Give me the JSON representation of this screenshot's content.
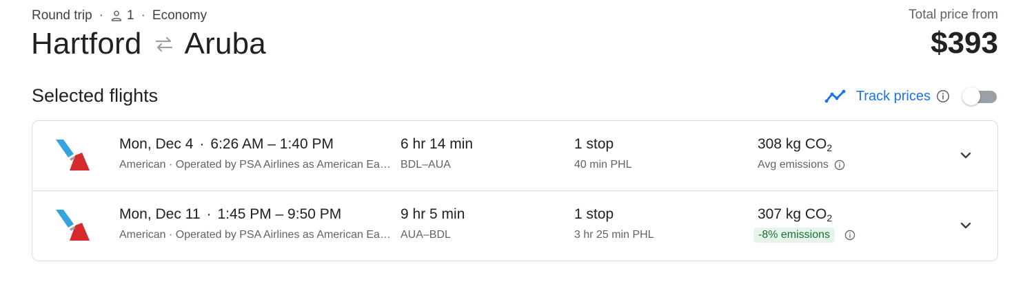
{
  "header": {
    "trip_type": "Round trip",
    "passengers": "1",
    "cabin": "Economy",
    "origin": "Hartford",
    "destination": "Aruba",
    "total_price_label": "Total price from",
    "total_price": "$393"
  },
  "section": {
    "title": "Selected flights",
    "track_prices_label": "Track prices",
    "track_prices_enabled": false
  },
  "flights": [
    {
      "date": "Mon, Dec 4",
      "time_range": "6:26 AM – 1:40 PM",
      "airline_info": "American · Operated by PSA Airlines as American Eagle",
      "duration": "6 hr 14 min",
      "airports": "BDL–AUA",
      "stops": "1 stop",
      "layover": "40 min PHL",
      "co2_value": "308 kg CO",
      "co2_sub": "2",
      "emissions_label": "Avg emissions"
    },
    {
      "date": "Mon, Dec 11",
      "time_range": "1:45 PM – 9:50 PM",
      "airline_info": "American · Operated by PSA Airlines as American Eagle",
      "duration": "9 hr 5 min",
      "airports": "AUA–BDL",
      "stops": "1 stop",
      "layover": "3 hr 25 min PHL",
      "co2_value": "307 kg CO",
      "co2_sub": "2",
      "emissions_label": "-8% emissions"
    }
  ],
  "colors": {
    "accent": "#1a73e8",
    "text_primary": "#202124",
    "text_secondary": "#5f6368",
    "border": "#dadce0",
    "badge_bg": "#e6f4ea",
    "badge_text": "#137333",
    "logo_blue": "#36a3e0",
    "logo_red": "#d52b2e"
  },
  "icons": {
    "passenger": "person-icon",
    "swap": "swap-arrows-icon",
    "track": "trend-line-icon",
    "info": "info-icon",
    "expand": "chevron-down-icon",
    "airline_logo": "american-airlines-logo"
  }
}
